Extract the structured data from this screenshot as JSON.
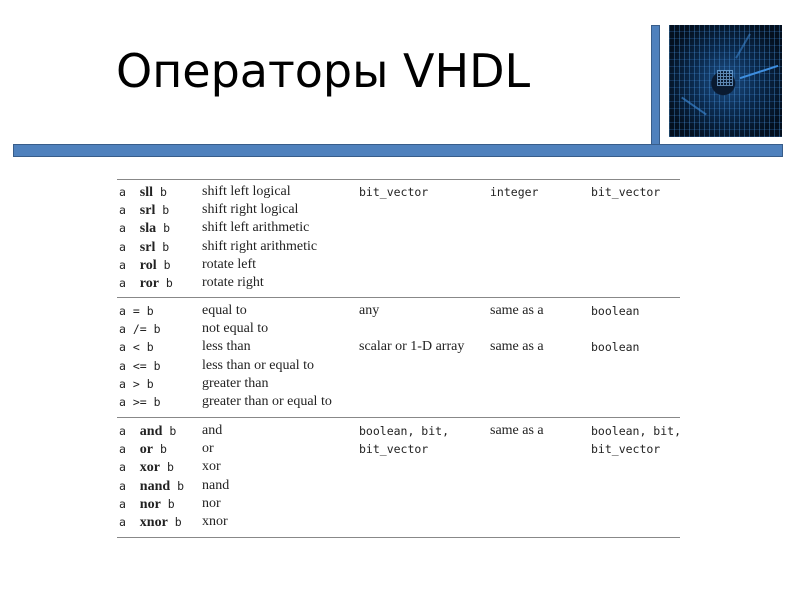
{
  "slide": {
    "title": "Операторы VHDL",
    "image": "circuit-board-chip-image"
  },
  "table": {
    "groups": [
      {
        "rows": [
          {
            "a": "a",
            "op": "sll",
            "b": "b",
            "desc": "shift left logical"
          },
          {
            "a": "a",
            "op": "srl",
            "b": "b",
            "desc": "shift right logical"
          },
          {
            "a": "a",
            "op": "sla",
            "b": "b",
            "desc": "shift left arithmetic"
          },
          {
            "a": "a",
            "op": "srl",
            "b": "b",
            "desc": "shift right arithmetic"
          },
          {
            "a": "a",
            "op": "rol",
            "b": "b",
            "desc": "rotate left"
          },
          {
            "a": "a",
            "op": "ror",
            "b": "b",
            "desc": "rotate right"
          }
        ],
        "types": [
          {
            "row": 0,
            "type_a": "bit_vector",
            "type_a_mono": true,
            "type_b": "integer",
            "type_b_mono": true,
            "result": "bit_vector",
            "result_mono": true
          }
        ]
      },
      {
        "rows": [
          {
            "a": "a",
            "op": "=",
            "b": "b",
            "desc": "equal to"
          },
          {
            "a": "a",
            "op": "/=",
            "b": "b",
            "desc": "not equal to"
          },
          {
            "a": "a",
            "op": "<",
            "b": "b",
            "desc": "less than"
          },
          {
            "a": "a",
            "op": "<=",
            "b": "b",
            "desc": "less than or equal to"
          },
          {
            "a": "a",
            "op": ">",
            "b": "b",
            "desc": "greater than"
          },
          {
            "a": "a",
            "op": ">=",
            "b": "b",
            "desc": "greater than or equal to"
          }
        ],
        "types": [
          {
            "row": 0,
            "type_a": "any",
            "type_a_mono": false,
            "type_b": "same as a",
            "type_b_mono": false,
            "result": "boolean",
            "result_mono": true
          },
          {
            "row": 2,
            "type_a": "scalar or 1-D array",
            "type_a_mono": false,
            "type_b": "same as a",
            "type_b_mono": false,
            "result": "boolean",
            "result_mono": true
          }
        ]
      },
      {
        "rows": [
          {
            "a": "a",
            "op": "and",
            "b": "b",
            "desc": "and"
          },
          {
            "a": "a",
            "op": "or",
            "b": "b",
            "desc": "or"
          },
          {
            "a": "a",
            "op": "xor",
            "b": "b",
            "desc": "xor"
          },
          {
            "a": "a",
            "op": "nand",
            "b": "b",
            "desc": "nand"
          },
          {
            "a": "a",
            "op": "nor",
            "b": "b",
            "desc": "nor"
          },
          {
            "a": "a",
            "op": "xnor",
            "b": "b",
            "desc": "xnor"
          }
        ],
        "types": [
          {
            "row": 0,
            "type_a": "boolean, bit,",
            "type_a_mono": true,
            "type_b": "same as a",
            "type_b_mono": false,
            "result": "boolean, bit,",
            "result_mono": true
          },
          {
            "row": 1,
            "type_a": "bit_vector",
            "type_a_mono": true,
            "type_b": "",
            "type_b_mono": false,
            "result": "bit_vector",
            "result_mono": true
          }
        ]
      }
    ]
  }
}
